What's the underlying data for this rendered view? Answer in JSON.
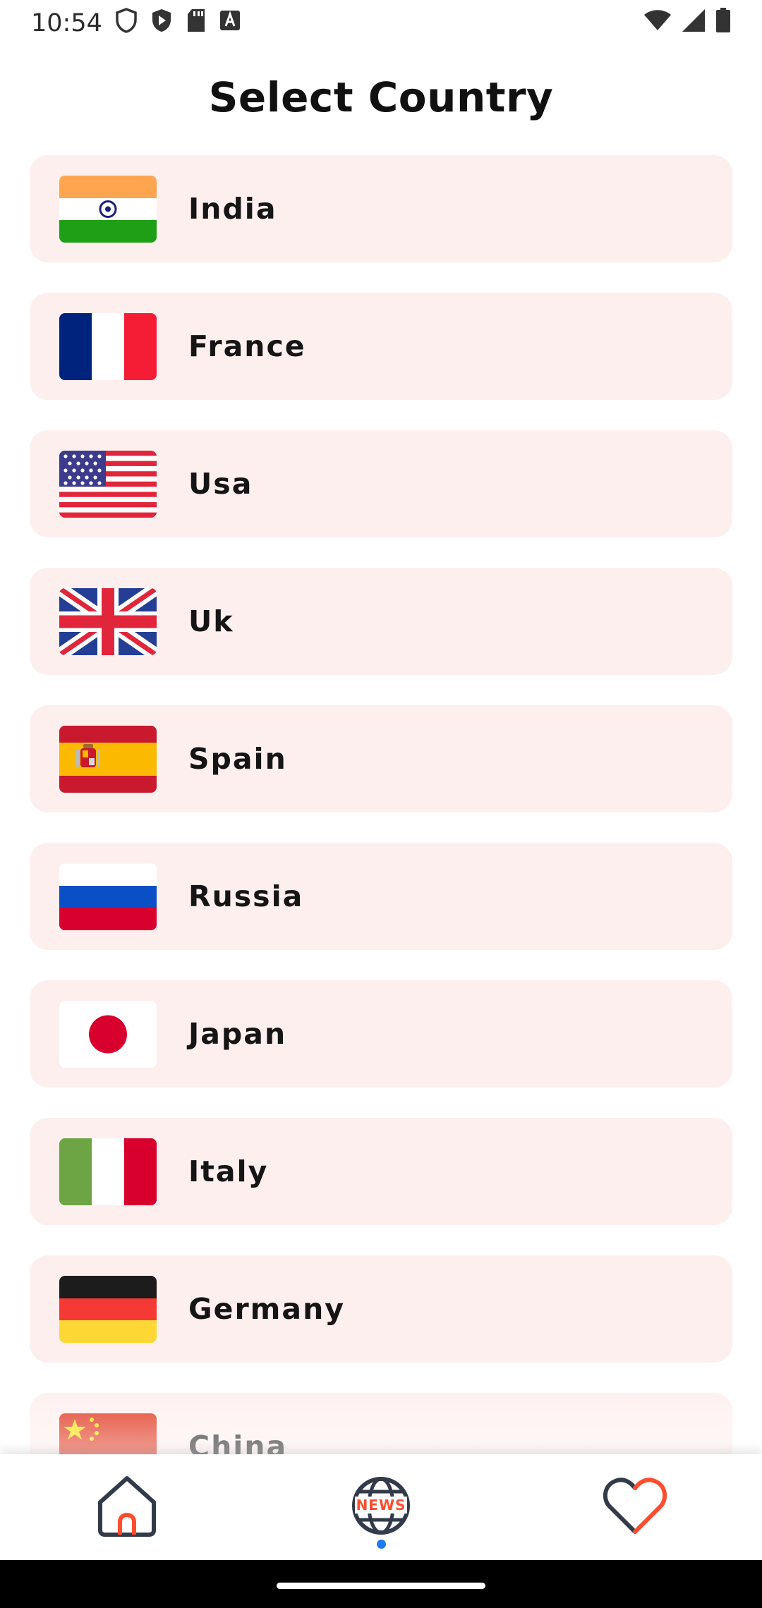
{
  "status_bar": {
    "time": "10:54",
    "left_icons": [
      "shield-icon",
      "play-protect-icon",
      "sd-card-icon",
      "font-a-icon"
    ],
    "right_icons": [
      "wifi-icon",
      "signal-icon",
      "battery-icon"
    ]
  },
  "page": {
    "title": "Select Country"
  },
  "countries": [
    {
      "name": "India",
      "flag": "india-flag-icon"
    },
    {
      "name": "France",
      "flag": "france-flag-icon"
    },
    {
      "name": "Usa",
      "flag": "usa-flag-icon"
    },
    {
      "name": "Uk",
      "flag": "uk-flag-icon"
    },
    {
      "name": "Spain",
      "flag": "spain-flag-icon"
    },
    {
      "name": "Russia",
      "flag": "russia-flag-icon"
    },
    {
      "name": "Japan",
      "flag": "japan-flag-icon"
    },
    {
      "name": "Italy",
      "flag": "italy-flag-icon"
    },
    {
      "name": "Germany",
      "flag": "germany-flag-icon"
    },
    {
      "name": "China",
      "flag": "china-flag-icon"
    }
  ],
  "bottom_nav": {
    "items": [
      {
        "icon": "home-icon",
        "selected": false
      },
      {
        "icon": "news-globe-icon",
        "label": "NEWS",
        "selected": true
      },
      {
        "icon": "heart-icon",
        "selected": false
      }
    ]
  },
  "colors": {
    "card_background": "#fdefed",
    "accent_orange": "#ff4d2e",
    "selected_dot": "#1e7bf2"
  }
}
